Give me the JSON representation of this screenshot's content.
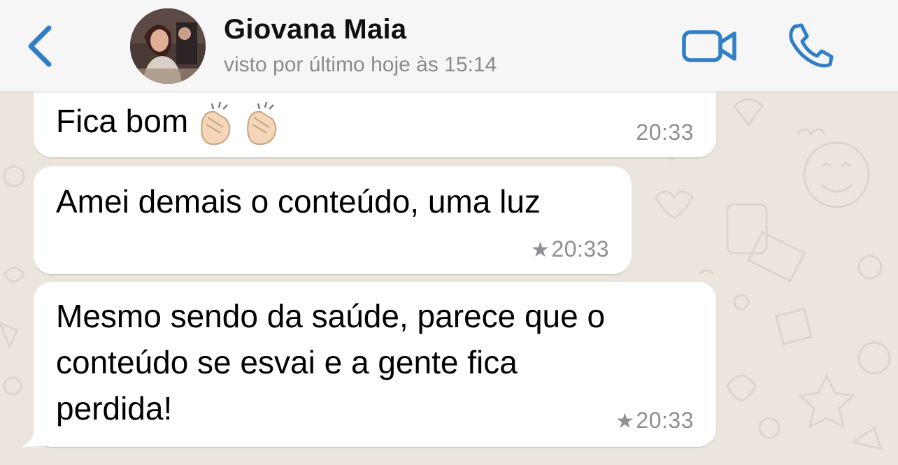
{
  "header": {
    "contact_name": "Giovana Maia",
    "status": "visto por último hoje às 15:14",
    "back_icon": "chevron-left-icon",
    "video_icon": "video-camera-icon",
    "phone_icon": "phone-icon",
    "accent_color": "#2f7ec7"
  },
  "messages": [
    {
      "text": "Fica bom",
      "emoji": "clapping-hands x2",
      "time": "20:33",
      "starred": false
    },
    {
      "text": "Amei demais o conteúdo, uma luz",
      "time": "20:33",
      "starred": true
    },
    {
      "lines": [
        "Mesmo sendo da saúde, parece que o",
        "conteúdo se esvai e a gente fica",
        "perdida!"
      ],
      "time": "20:33",
      "starred": true
    }
  ],
  "colors": {
    "header_bg": "#f6f6f6",
    "chat_bg": "#ece5dd",
    "bubble_bg": "#ffffff",
    "meta_text": "#8e8e93"
  }
}
